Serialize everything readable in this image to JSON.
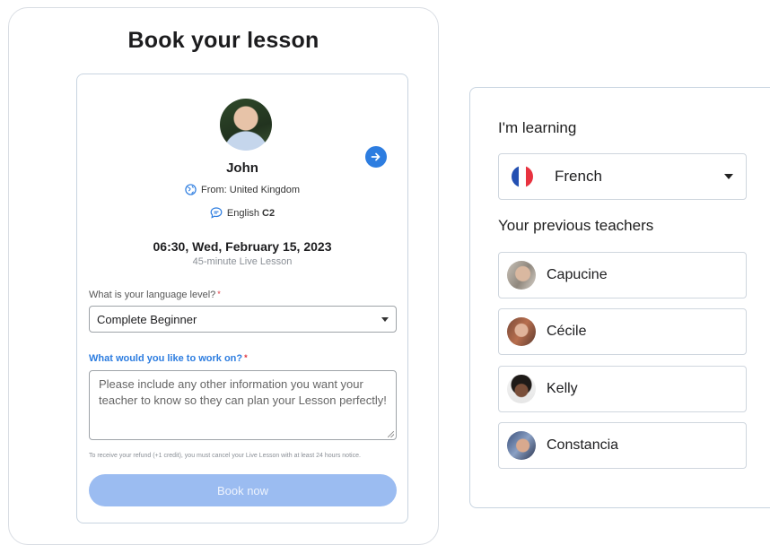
{
  "booking": {
    "title": "Book your lesson",
    "teacher": {
      "name": "John",
      "from": "From: United Kingdom",
      "language": "English",
      "level": "C2"
    },
    "datetime": "06:30, Wed, February 15, 2023",
    "duration": "45-minute Live Lesson",
    "level_question": "What is your language level?",
    "level_required": "*",
    "level_value": "Complete Beginner",
    "work_question": "What would you like to work on?",
    "work_required": "*",
    "work_placeholder": "Please include any other information you want your teacher to know so they can plan your Lesson perfectly!",
    "notice": "To receive your refund (+1 credit), you must cancel your Live Lesson with at least 24 hours notice.",
    "book_label": "Book now",
    "icons": {
      "next": "arrow-right-icon",
      "globe": "globe-icon",
      "chat": "chat-bubble-icon"
    },
    "colors": {
      "accent": "#2d7de0",
      "button_disabled": "#9bbcf1",
      "required": "#e0323c"
    }
  },
  "learning": {
    "heading": "I'm learning",
    "language": "French",
    "flag_icon": "france-flag-icon",
    "teachers_heading": "Your previous teachers",
    "teachers": [
      {
        "name": "Capucine"
      },
      {
        "name": "Cécile"
      },
      {
        "name": "Kelly"
      },
      {
        "name": "Constancia"
      }
    ]
  }
}
